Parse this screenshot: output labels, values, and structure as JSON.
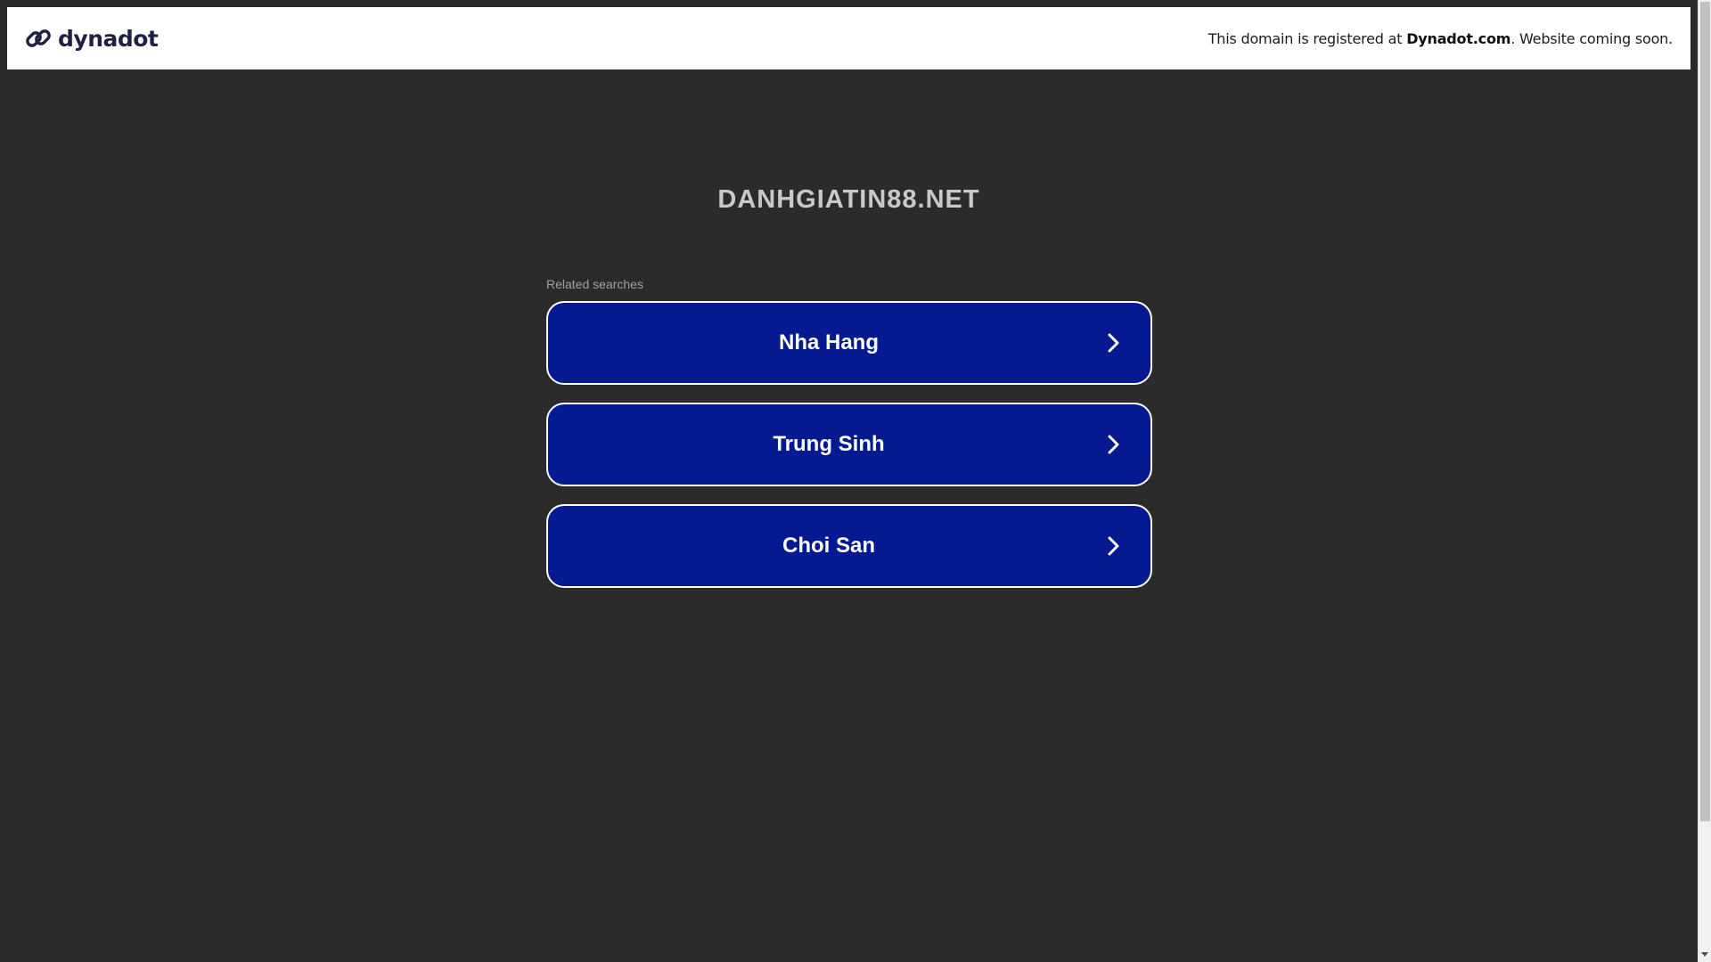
{
  "banner": {
    "logo_text": "dynadot",
    "message_prefix": "This domain is registered at ",
    "message_brand": "Dynadot.com",
    "message_suffix": ". Website coming soon."
  },
  "domain": {
    "title": "DANHGIATIN88.NET"
  },
  "related": {
    "label": "Related searches",
    "items": [
      {
        "label": "Nha Hang"
      },
      {
        "label": "Trung Sinh"
      },
      {
        "label": "Choi San"
      }
    ]
  },
  "colors": {
    "page_background": "#2b2b2b",
    "banner_background": "#ffffff",
    "button_background": "#051991",
    "button_border": "#ffffff",
    "logo_color": "#1f2044"
  },
  "icons": {
    "logo": "dynadot-link-icon",
    "button_arrow": "chevron-right-icon"
  }
}
